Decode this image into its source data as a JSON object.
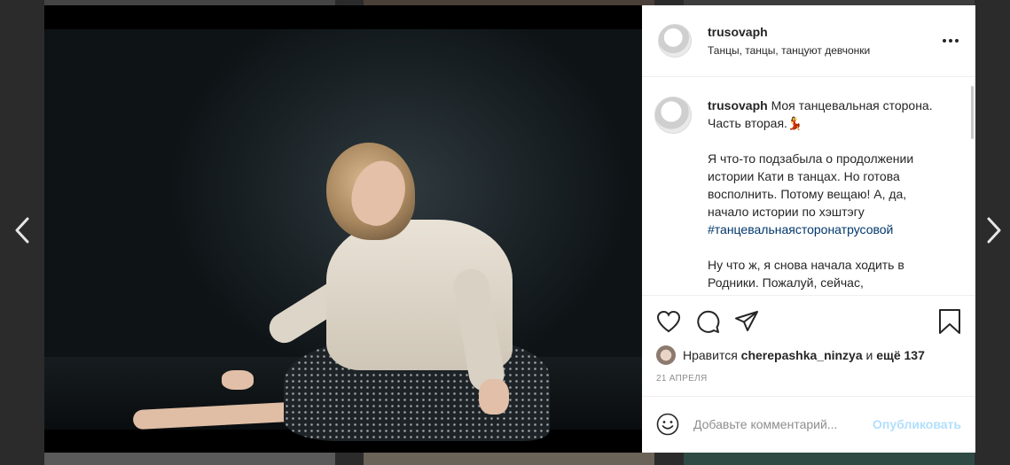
{
  "post": {
    "username": "trusovaph",
    "location": "Танцы, танцы, танцуют девчонки",
    "caption_user": "trusovaph",
    "caption_line1": " Моя танцевальная сторона. Часть вторая.💃",
    "caption_p2": "Я что-то подзабыла о продолжении истории Кати в танцах. Но готова восполнить. Потому вещаю! А, да, начало истории по хэштэгу",
    "hashtag": "#танцевальнаясторонатрусовой",
    "caption_p3": "Ну что ж, я снова начала ходить в Родники. Пожалуй, сейчас,"
  },
  "likes": {
    "prefix": "Нравится",
    "user": "cherepashka_ninzya",
    "and": "и",
    "more": "ещё 137"
  },
  "date": "21 АПРЕЛЯ",
  "comment": {
    "placeholder": "Добавьте комментарий...",
    "publish": "Опубликовать"
  },
  "icons": {
    "like": "heart-icon",
    "comment": "comment-icon",
    "share": "share-icon",
    "save": "bookmark-icon",
    "more": "more-dots-icon",
    "emoji": "emoji-icon",
    "prev": "chevron-left-icon",
    "next": "chevron-right-icon"
  },
  "colors": {
    "hashtag": "#00376b",
    "publish_disabled": "#b2dffc",
    "muted": "#8e8e8e"
  }
}
